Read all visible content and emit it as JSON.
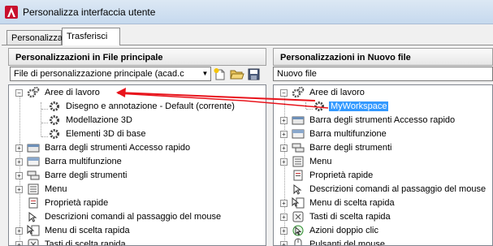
{
  "window": {
    "title": "Personalizza interfaccia utente"
  },
  "tabs": [
    {
      "label": "Personalizza"
    },
    {
      "label": "Trasferisci"
    }
  ],
  "left": {
    "header": "Personalizzazioni in File principale",
    "combo_value": "File di personalizzazione principale (acad.c",
    "tree": [
      "Aree di lavoro",
      "Disegno e annotazione - Default (corrente)",
      "Modellazione 3D",
      "Elementi 3D di base",
      "Barra degli strumenti Accesso rapido",
      "Barra multifunzione",
      "Barre degli strumenti",
      "Menu",
      "Proprietà rapide",
      "Descrizioni comandi al passaggio del mouse",
      "Menu di scelta rapida",
      "Tasti di scelta rapida"
    ]
  },
  "right": {
    "header": "Personalizzazioni in Nuovo file",
    "combo_value": "Nuovo file",
    "tree": [
      "Aree di lavoro",
      "MyWorkspace",
      "Barra degli strumenti Accesso rapido",
      "Barra multifunzione",
      "Barre degli strumenti",
      "Menu",
      "Proprietà rapide",
      "Descrizioni comandi al passaggio del mouse",
      "Menu di scelta rapida",
      "Tasti di scelta rapida",
      "Azioni doppio clic",
      "Pulsanti del mouse"
    ]
  },
  "colors": {
    "selection": "#3399ff",
    "drag_arrow": "#e8141c",
    "title_bar": "#c6d9ee"
  }
}
